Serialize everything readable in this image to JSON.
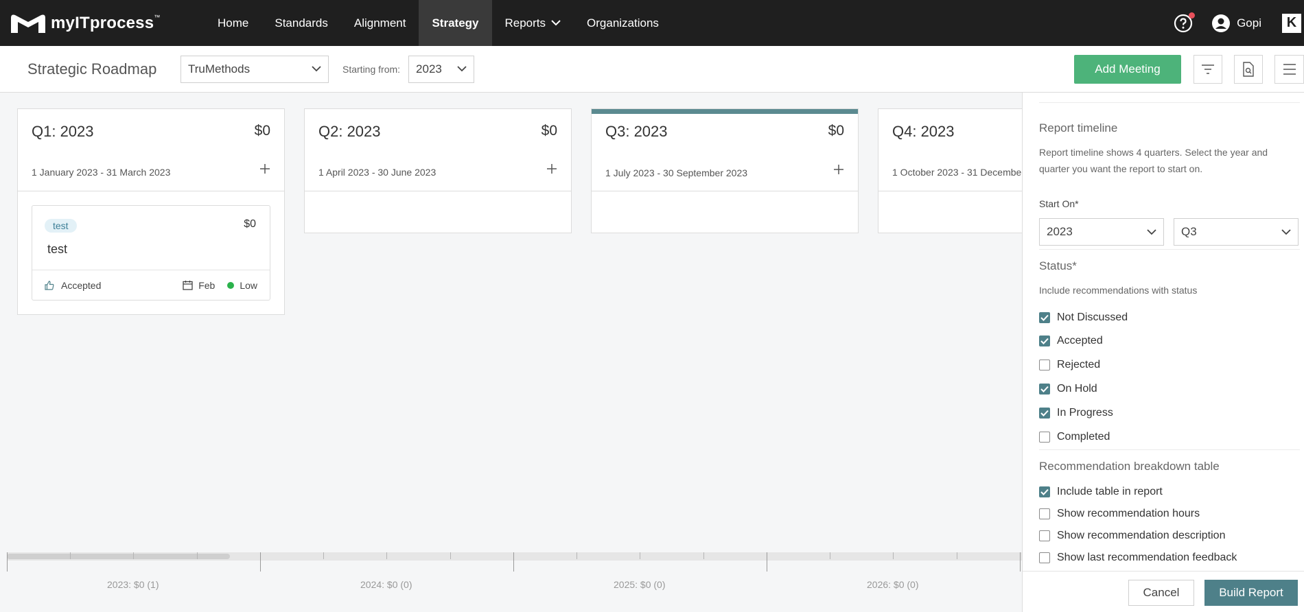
{
  "brand": {
    "name": "myITprocess",
    "tm": "™",
    "corner_logo": "K"
  },
  "nav": {
    "items": [
      {
        "label": "Home"
      },
      {
        "label": "Standards"
      },
      {
        "label": "Alignment"
      },
      {
        "label": "Strategy",
        "active": true
      },
      {
        "label": "Reports",
        "has_dropdown": true
      },
      {
        "label": "Organizations"
      }
    ],
    "user": "Gopi",
    "help_icon": "help-circle-icon"
  },
  "toolbar": {
    "title": "Strategic Roadmap",
    "org_value": "TruMethods",
    "starting_label": "Starting from:",
    "year_value": "2023",
    "add_meeting_label": "Add Meeting",
    "icons": [
      "filter-icon",
      "report-preview-icon",
      "menu-icon"
    ]
  },
  "quarters": [
    {
      "title": "Q1: 2023",
      "amount": "$0",
      "dates": "1 January 2023 - 31 March 2023"
    },
    {
      "title": "Q2: 2023",
      "amount": "$0",
      "dates": "1 April 2023 - 30 June 2023"
    },
    {
      "title": "Q3: 2023",
      "amount": "$0",
      "dates": "1 July 2023 - 30 September 2023"
    },
    {
      "title": "Q4: 2023",
      "amount": "",
      "dates": "1 October 2023 - 31 Decembe"
    }
  ],
  "card": {
    "tag": "test",
    "amount": "$0",
    "title": "test",
    "status": "Accepted",
    "month": "Feb",
    "priority": "Low"
  },
  "timeline": {
    "labels": [
      "2023: $0 (1)",
      "2024: $0 (0)",
      "2025: $0 (0)",
      "2026: $0 (0)"
    ]
  },
  "panel": {
    "timeline_title": "Report timeline",
    "timeline_desc": "Report timeline shows 4 quarters. Select the year and quarter you want the report to start on.",
    "start_on_label": "Start On*",
    "start_year": "2023",
    "start_quarter": "Q3",
    "status_title": "Status*",
    "status_desc": "Include recommendations with status",
    "statuses": [
      {
        "label": "Not Discussed",
        "checked": true
      },
      {
        "label": "Accepted",
        "checked": true
      },
      {
        "label": "Rejected",
        "checked": false
      },
      {
        "label": "On Hold",
        "checked": true
      },
      {
        "label": "In Progress",
        "checked": true
      },
      {
        "label": "Completed",
        "checked": false
      }
    ],
    "breakdown_title": "Recommendation breakdown table",
    "breakdown_options": [
      {
        "label": "Include table in report",
        "checked": true
      },
      {
        "label": "Show recommendation hours",
        "checked": false
      },
      {
        "label": "Show recommendation description",
        "checked": false
      },
      {
        "label": "Show last recommendation feedback",
        "checked": false
      }
    ],
    "cancel_label": "Cancel",
    "build_label": "Build Report"
  },
  "colors": {
    "nav_bg": "#1f1f1f",
    "accent_green": "#4db37a",
    "accent_teal": "#4e8089",
    "priority_low": "#2bb24c"
  }
}
